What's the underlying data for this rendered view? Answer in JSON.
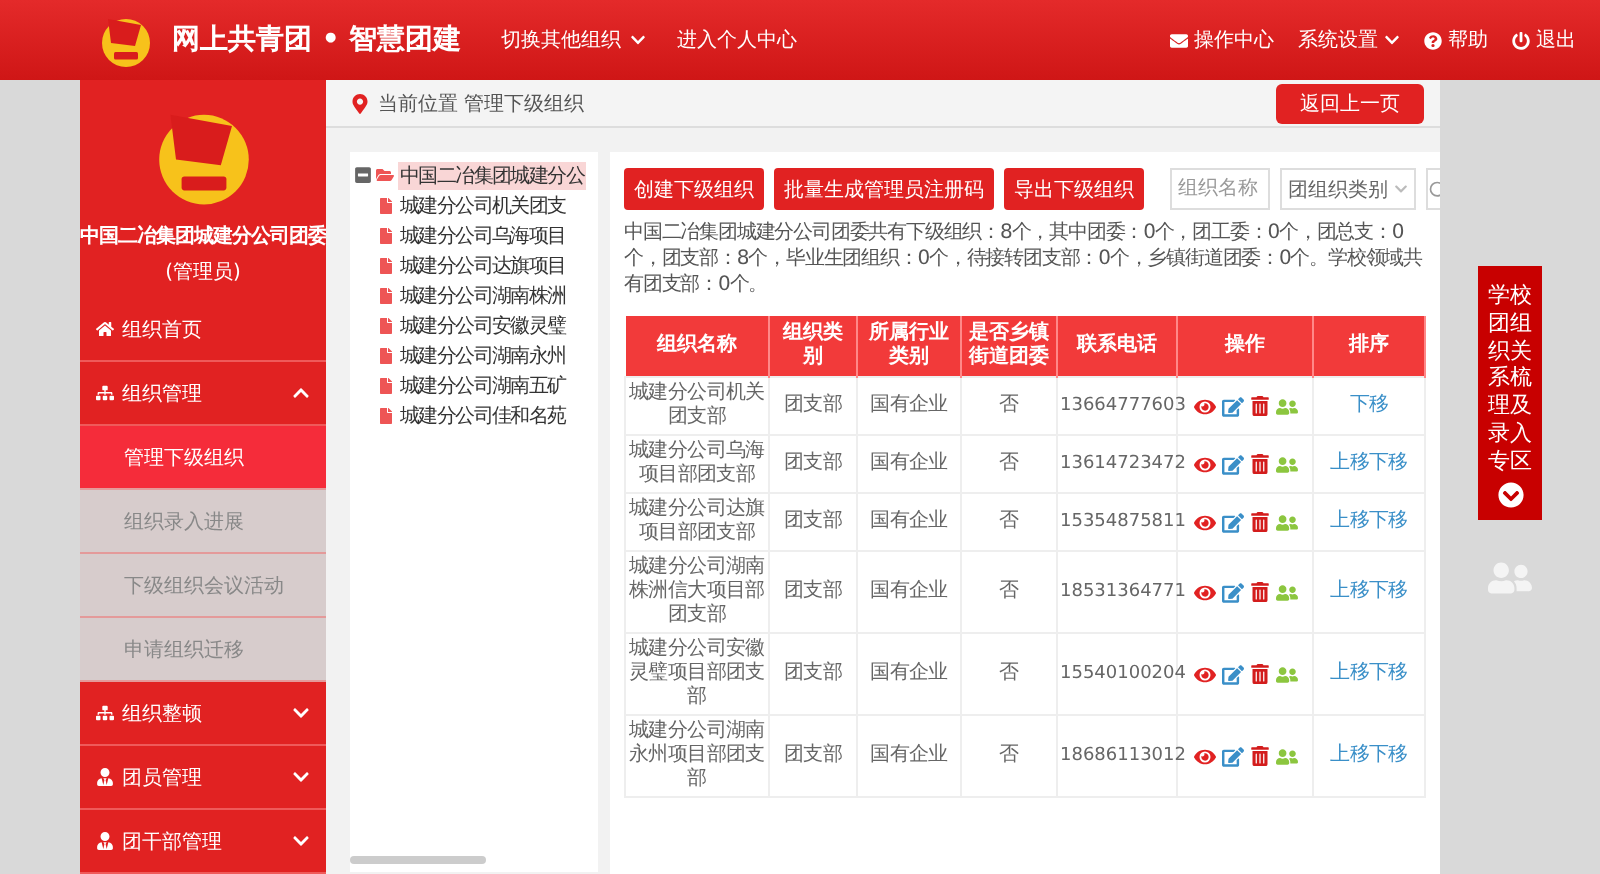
{
  "header": {
    "title": "网上共青团 • 智慧团建",
    "nav": [
      {
        "label": "切换其他组织",
        "dropdown": true
      },
      {
        "label": "进入个人中心",
        "dropdown": false
      }
    ],
    "actions": [
      {
        "label": "操作中心",
        "kind": "mail",
        "dropdown": false
      },
      {
        "label": "系统设置",
        "kind": "settings",
        "dropdown": true
      },
      {
        "label": "帮助",
        "kind": "help",
        "dropdown": false
      },
      {
        "label": "退出",
        "kind": "logout",
        "dropdown": false
      }
    ]
  },
  "breadcrumb": {
    "text": "当前位置 管理下级组织",
    "back_button": "返回上一页"
  },
  "sidebar": {
    "org_name": "中国二冶集团城建分公司团委",
    "role": "(管理员)",
    "items": [
      {
        "label": "组织首页",
        "kind": "home"
      },
      {
        "label": "组织管理",
        "kind": "sitemap",
        "expanded": true,
        "children": [
          {
            "label": "管理下级组织",
            "selected": true
          },
          {
            "label": "组织录入进展",
            "selected": false
          },
          {
            "label": "下级组织会议活动",
            "selected": false
          },
          {
            "label": "申请组织迁移",
            "selected": false
          }
        ]
      },
      {
        "label": "组织整顿",
        "kind": "sitemap",
        "expanded": false
      },
      {
        "label": "团员管理",
        "kind": "users",
        "expanded": false
      },
      {
        "label": "团干部管理",
        "kind": "users",
        "expanded": false
      }
    ]
  },
  "tree": {
    "label": "中国二冶集团城建分公",
    "expanded": true,
    "selected": true,
    "children": [
      {
        "label": "城建分公司机关团支",
        "selected": false
      },
      {
        "label": "城建分公司乌海项目",
        "selected": false
      },
      {
        "label": "城建分公司达旗项目",
        "selected": false
      },
      {
        "label": "城建分公司湖南株洲",
        "selected": false
      },
      {
        "label": "城建分公司安徽灵璧",
        "selected": false
      },
      {
        "label": "城建分公司湖南永州",
        "selected": false
      },
      {
        "label": "城建分公司湖南五矿",
        "selected": false
      },
      {
        "label": "城建分公司佳和名苑",
        "selected": false
      }
    ]
  },
  "toolbar": {
    "buttons": [
      "创建下级组织",
      "批量生成管理员注册码",
      "导出下级组织"
    ],
    "search": {
      "placeholder": "组织名称"
    },
    "category_select": "团组织类别"
  },
  "summary": "中国二冶集团城建分公司团委共有下级组织：8个，其中团委：0个，团工委：0个，团总支：0个，团支部：8个，毕业生团组织：0个，待接转团支部：0个，乡镇街道团委：0个。学校领域共有团支部：0个。",
  "table": {
    "columns": [
      "组织名称",
      "组织类别",
      "所属行业类别",
      "是否乡镇街道团委",
      "联系电话",
      "操作",
      "排序"
    ],
    "rows": [
      {
        "name": "城建分公司机关团支部",
        "type": "团支部",
        "industry": "国有企业",
        "street": "否",
        "phone": "13664777603",
        "sort": [
          "下移"
        ]
      },
      {
        "name": "城建分公司乌海项目部团支部",
        "type": "团支部",
        "industry": "国有企业",
        "street": "否",
        "phone": "13614723472",
        "sort": [
          "上移",
          "下移"
        ]
      },
      {
        "name": "城建分公司达旗项目部团支部",
        "type": "团支部",
        "industry": "国有企业",
        "street": "否",
        "phone": "15354875811",
        "sort": [
          "上移",
          "下移"
        ]
      },
      {
        "name": "城建分公司湖南株洲信大项目部团支部",
        "type": "团支部",
        "industry": "国有企业",
        "street": "否",
        "phone": "18531364771",
        "sort": [
          "上移",
          "下移"
        ]
      },
      {
        "name": "城建分公司安徽灵璧项目部团支部",
        "type": "团支部",
        "industry": "国有企业",
        "street": "否",
        "phone": "15540100204",
        "sort": [
          "上移",
          "下移"
        ]
      },
      {
        "name": "城建分公司湖南永州项目部团支部",
        "type": "团支部",
        "industry": "国有企业",
        "street": "否",
        "phone": "18686113012",
        "sort": [
          "上移",
          "下移"
        ]
      }
    ]
  },
  "side_tab": {
    "label": "学校团组织关系梳理及录入专区"
  }
}
